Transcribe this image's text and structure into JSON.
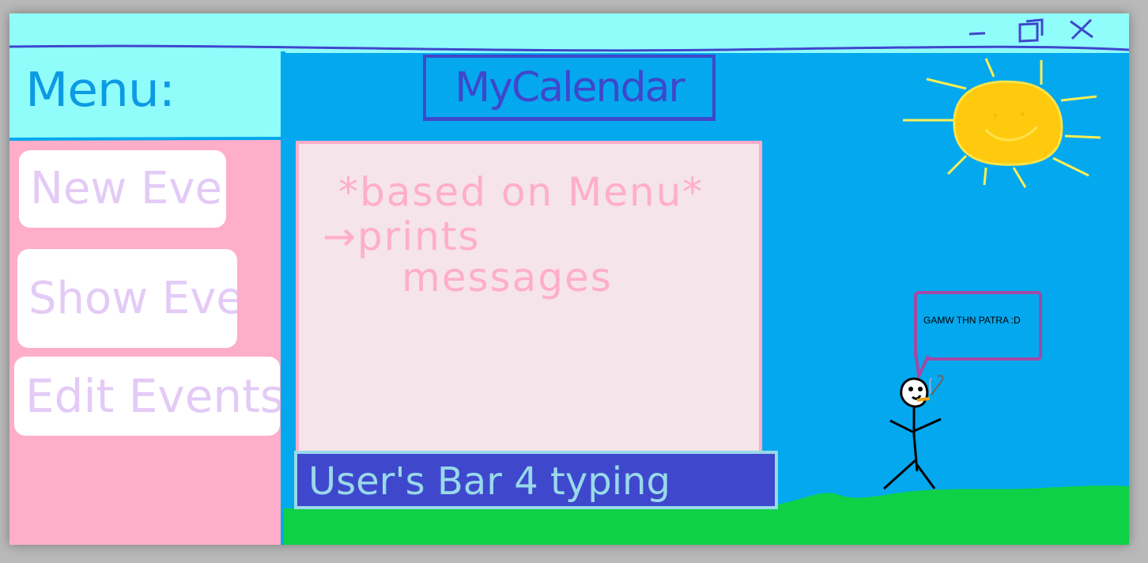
{
  "window": {
    "controls": {
      "minimize_icon": "minimize-icon",
      "maximize_icon": "maximize-icon",
      "close_icon": "close-icon"
    }
  },
  "menu": {
    "title": "Menu:",
    "items": [
      {
        "label": "New Event"
      },
      {
        "label": "Show Events"
      },
      {
        "label": "Edit Events"
      }
    ]
  },
  "header": {
    "title": "MyCalendar"
  },
  "messages": {
    "lines": [
      "*based on Menu*",
      "→prints",
      "messages"
    ]
  },
  "input": {
    "placeholder": "User's Bar 4 typing"
  },
  "bubble": {
    "text": "GAMW THN PATRA :D"
  },
  "colors": {
    "sky": "#04a8ee",
    "titlebar": "#90fdfb",
    "menu_bg": "#feaec9",
    "button_text": "#e3cbf6",
    "heading": "#3f47cc",
    "message_bg": "#f5e4e9",
    "message_text": "#ffaec9",
    "input_bg": "#3f48cc",
    "input_text": "#99d9ea",
    "grass": "#0fd146",
    "sun": "#ffc90e",
    "bubble_border": "#a349a4"
  }
}
